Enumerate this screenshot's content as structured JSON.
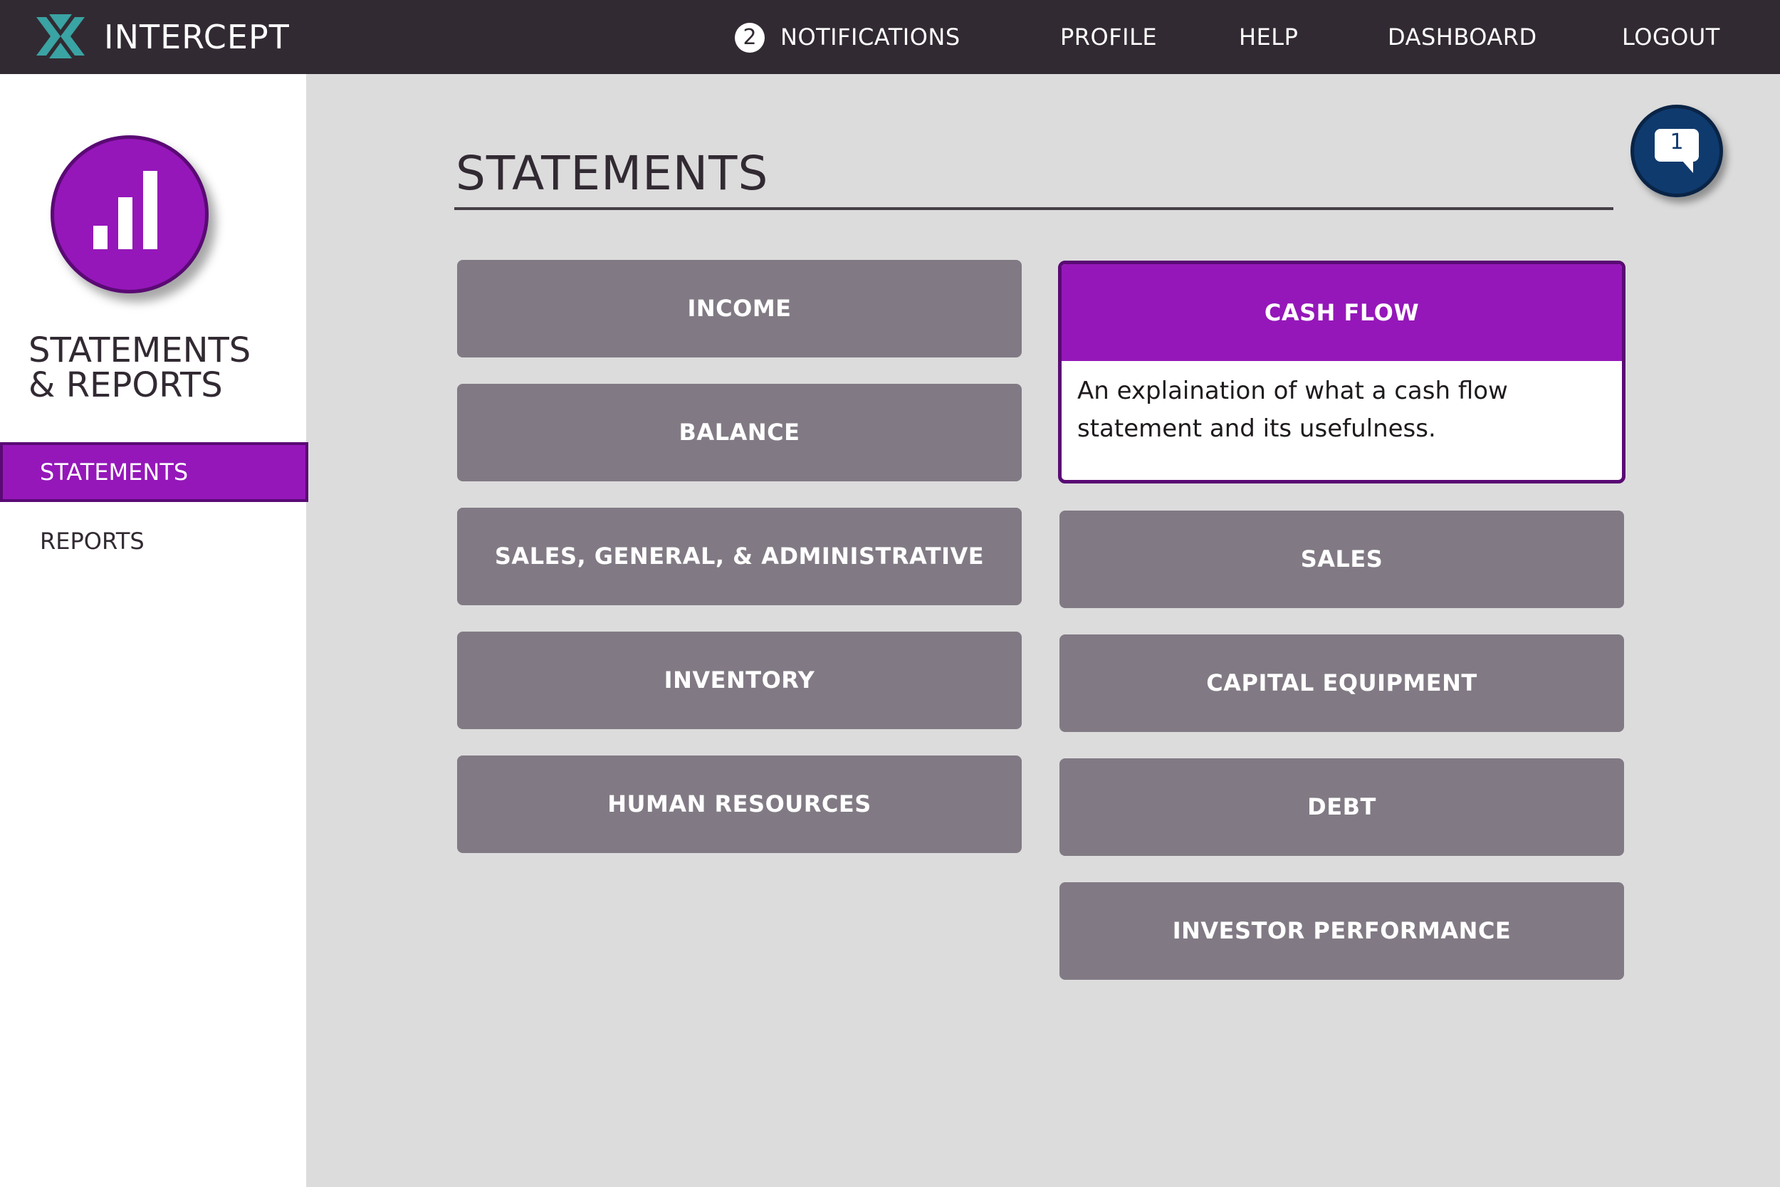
{
  "header": {
    "brand": "INTERCEPT",
    "notifications_count": "2",
    "nav": [
      "NOTIFICATIONS",
      "PROFILE",
      "HELP",
      "DASHBOARD",
      "LOGOUT"
    ]
  },
  "sidebar": {
    "title_line1": "STATEMENTS",
    "title_line2": "& REPORTS",
    "items": [
      {
        "label": "STATEMENTS",
        "active": true
      },
      {
        "label": "REPORTS",
        "active": false
      }
    ]
  },
  "main": {
    "title": "STATEMENTS",
    "chat_count": "1",
    "tiles_left": [
      "INCOME",
      "BALANCE",
      "SALES, GENERAL, & ADMINISTRATIVE",
      "INVENTORY",
      "HUMAN RESOURCES"
    ],
    "expanded_tile": {
      "label": "CASH FLOW",
      "description": "An explaination of what a cash flow statement and its usefulness."
    },
    "tiles_right": [
      "SALES",
      "CAPITAL EQUIPMENT",
      "DEBT",
      "INVESTOR PERFORMANCE"
    ]
  },
  "colors": {
    "topbar": "#322a32",
    "accent_purple": "#9517b9",
    "tile_gray": "#817a84",
    "chat_blue": "#0f3a6e",
    "logo_teal": "#3aa3a3"
  },
  "icons": [
    "intercept-logo-icon",
    "bar-chart-icon",
    "chat-bubble-icon"
  ]
}
